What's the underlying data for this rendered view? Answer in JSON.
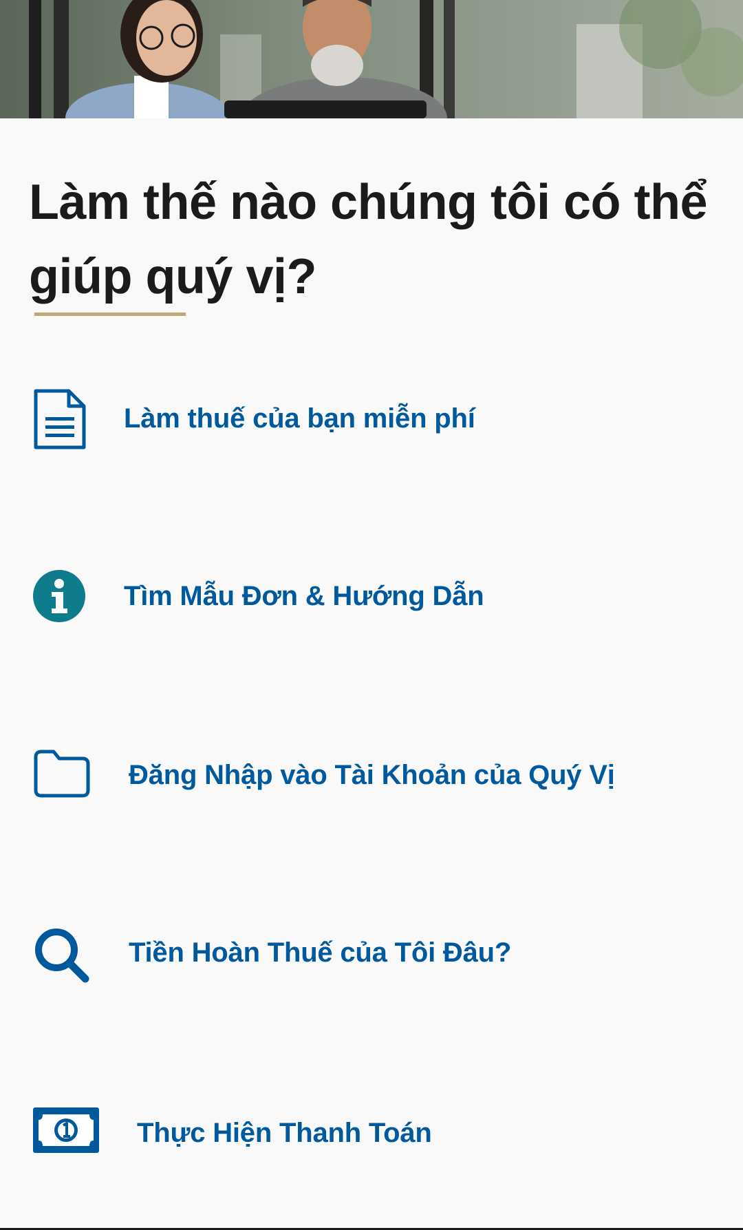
{
  "hero": {
    "image_alt": "hero-photo"
  },
  "heading": {
    "line1": "Làm thế nào chúng tôi có thể",
    "line2": "giúp quý vị?"
  },
  "menu": {
    "items": [
      {
        "label": "Làm thuế của bạn miễn phí",
        "icon": "document-icon"
      },
      {
        "label": "Tìm Mẫu Đơn & Hướng Dẫn",
        "icon": "info-icon"
      },
      {
        "label": "Đăng Nhập vào Tài Khoản của Quý Vị",
        "icon": "folder-icon"
      },
      {
        "label": "Tiền Hoàn Thuế của Tôi Đâu?",
        "icon": "search-icon"
      },
      {
        "label": "Thực Hiện Thanh Toán",
        "icon": "money-icon"
      }
    ]
  },
  "colors": {
    "link": "#00599c",
    "heading": "#1b1b1b",
    "accent_underline": "#c2a878",
    "info_icon": "#0f7c8b",
    "background": "#f9f9f9"
  }
}
